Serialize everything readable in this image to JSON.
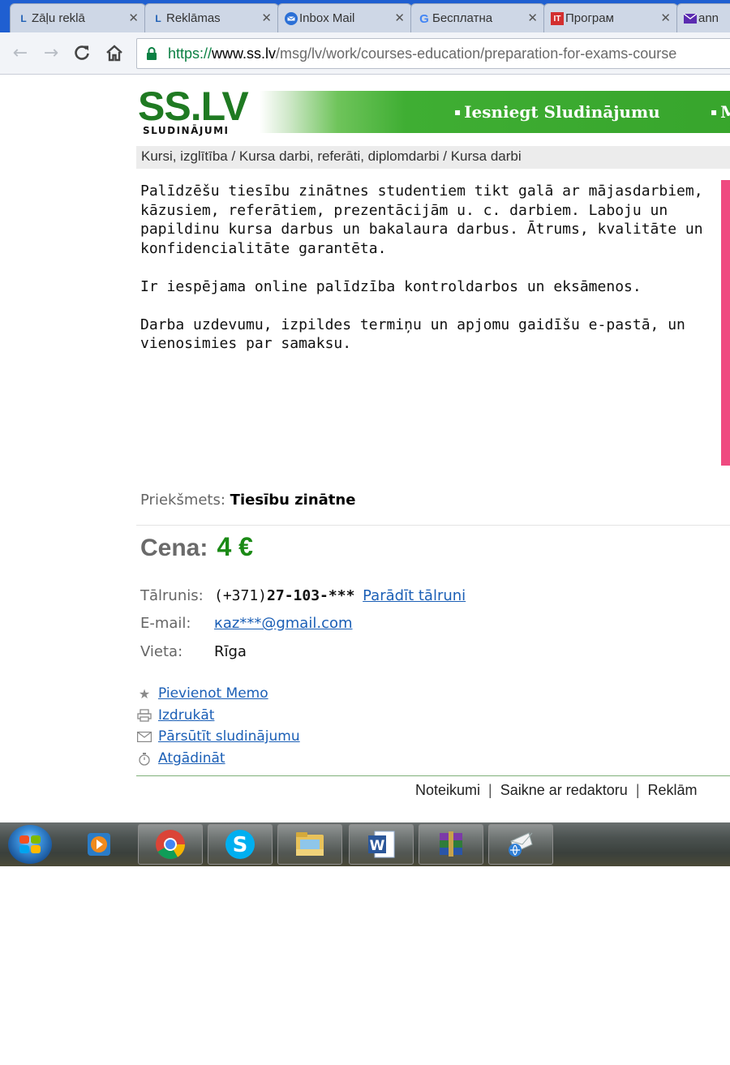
{
  "browser": {
    "tabs": [
      {
        "title": "Zāļu reklā",
        "favicon": "ss-l-icon"
      },
      {
        "title": "Reklāmas",
        "favicon": "ss-l-icon"
      },
      {
        "title": "Inbox Mail",
        "favicon": "mail-icon"
      },
      {
        "title": "Бесплатна",
        "favicon": "google-icon"
      },
      {
        "title": "Програм",
        "favicon": "it-icon"
      },
      {
        "title": "ann",
        "favicon": "yahoo-mail-icon"
      }
    ],
    "url_scheme": "https://",
    "url_host": "www.ss.lv",
    "url_path": "/msg/lv/work/courses-education/preparation-for-exams-course"
  },
  "site": {
    "logo": "SS.LV",
    "logo_sub": "SLUDINĀJUMI",
    "nav_submit": "Iesniegt Sludinājumu",
    "nav_more": "M",
    "bullet": "▪"
  },
  "breadcrumb": "Kursi, izglītība / Kursa darbi, referāti, diplomdarbi / Kursa darbi",
  "ad": {
    "paragraphs": [
      "Palīdzēšu tiesību zinātnes studentiem tikt galā ar mājasdarbiem, kāzusiem, referātiem, prezentācijām u. c. darbiem. Laboju un papildinu kursa darbus un bakalaura darbus. Ātrums, kvalitāte un konfidencialitāte garantēta.",
      "Ir iespējama online palīdzība kontroldarbos un eksāmenos.",
      "Darba uzdevumu, izpildes termiņu un apjomu gaidīšu e-pastā, un vienosimies par samaksu."
    ],
    "subject_label": "Priekšmets:",
    "subject_value": "Tiesību zinātne",
    "price_label": "Cena:",
    "price_value": "4 €",
    "phone_label": "Tālrunis:",
    "phone_prefix": "(+371)",
    "phone_number": "27-103-***",
    "show_phone": "Parādīt tālruni",
    "email_label": "E-mail:",
    "email_value": "кaz***@gmail.com",
    "location_label": "Vieta:",
    "location_value": "Rīga"
  },
  "actions": [
    {
      "label": "Pievienot Memo",
      "icon": "star-icon"
    },
    {
      "label": "Izdrukāt",
      "icon": "printer-icon"
    },
    {
      "label": "Pārsūtīt sludinājumu",
      "icon": "envelope-icon"
    },
    {
      "label": "Atgādināt",
      "icon": "stopwatch-icon"
    }
  ],
  "footer": {
    "rules": "Noteikumi",
    "contact": "Saikne ar redaktoru",
    "ads": "Reklām",
    "sep": "|"
  },
  "taskbar": {
    "items": [
      "windows-start-icon",
      "media-player-icon",
      "chrome-icon",
      "skype-icon",
      "file-explorer-icon",
      "word-icon",
      "winrar-icon",
      "mail-client-icon"
    ]
  }
}
